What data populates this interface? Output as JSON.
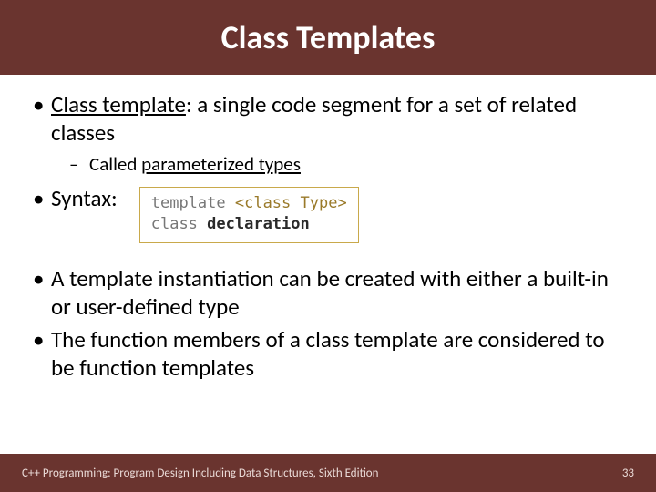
{
  "title": "Class Templates",
  "bullets": {
    "b1_term": "Class template",
    "b1_rest": ": a single code segment for a set of related classes",
    "b1_sub_prefix": "Called ",
    "b1_sub_under": "parameterized types",
    "b2": "Syntax:",
    "b3": "A template instantiation can be created with either a built-in or user-defined type",
    "b4": "The function members of a class template are considered to be function templates"
  },
  "code": {
    "line1_kw": "template ",
    "line1_ang": "<class Type>",
    "line2_kw": "class ",
    "line2_decl": "declaration"
  },
  "footer": {
    "text": "C++ Programming: Program Design Including Data Structures, Sixth Edition",
    "page": "33"
  },
  "colors": {
    "header_bg": "#6a342f",
    "code_border": "#c9a94b"
  }
}
